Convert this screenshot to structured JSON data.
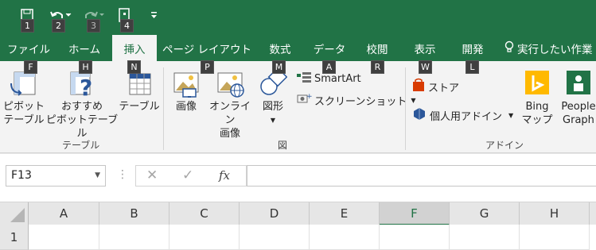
{
  "qat": {
    "keytips": [
      "1",
      "2",
      "3",
      "4"
    ]
  },
  "tabs": [
    {
      "label": "ファイル",
      "keytip": "F"
    },
    {
      "label": "ホーム",
      "keytip": "H"
    },
    {
      "label": "挿入",
      "keytip": "N"
    },
    {
      "label": "ページ レイアウト",
      "keytip": "P"
    },
    {
      "label": "数式",
      "keytip": "M"
    },
    {
      "label": "データ",
      "keytip": "A"
    },
    {
      "label": "校閲",
      "keytip": "R"
    },
    {
      "label": "表示",
      "keytip": "W"
    },
    {
      "label": "開発",
      "keytip": "L"
    },
    {
      "label": "実行したい作業",
      "keytip": ""
    }
  ],
  "ribbon": {
    "table_group": {
      "pivot_l1": "ピボット",
      "pivot_l2": "テーブル",
      "recpivot_l1": "おすすめ",
      "recpivot_l2": "ピボットテーブル",
      "table": "テーブル",
      "label": "テーブル"
    },
    "figure_group": {
      "image": "画像",
      "online_l1": "オンライン",
      "online_l2": "画像",
      "shapes": "図形",
      "smartart": "SmartArt",
      "screenshot": "スクリーンショット",
      "label": "図"
    },
    "addin_group": {
      "store": "ストア",
      "myaddins": "個人用アドイン",
      "bing_l1": "Bing",
      "bing_l2": "マップ",
      "people_l1": "People",
      "people_l2": "Graph",
      "label": "アドイン"
    }
  },
  "formula": {
    "namebox": "F13",
    "cancel": "✕",
    "enter": "✓",
    "fx": "fx"
  },
  "columns": [
    "A",
    "B",
    "C",
    "D",
    "E",
    "F",
    "G",
    "H"
  ],
  "selected_column": "F",
  "rows": [
    "1"
  ],
  "colors": {
    "excel_green": "#217346"
  }
}
